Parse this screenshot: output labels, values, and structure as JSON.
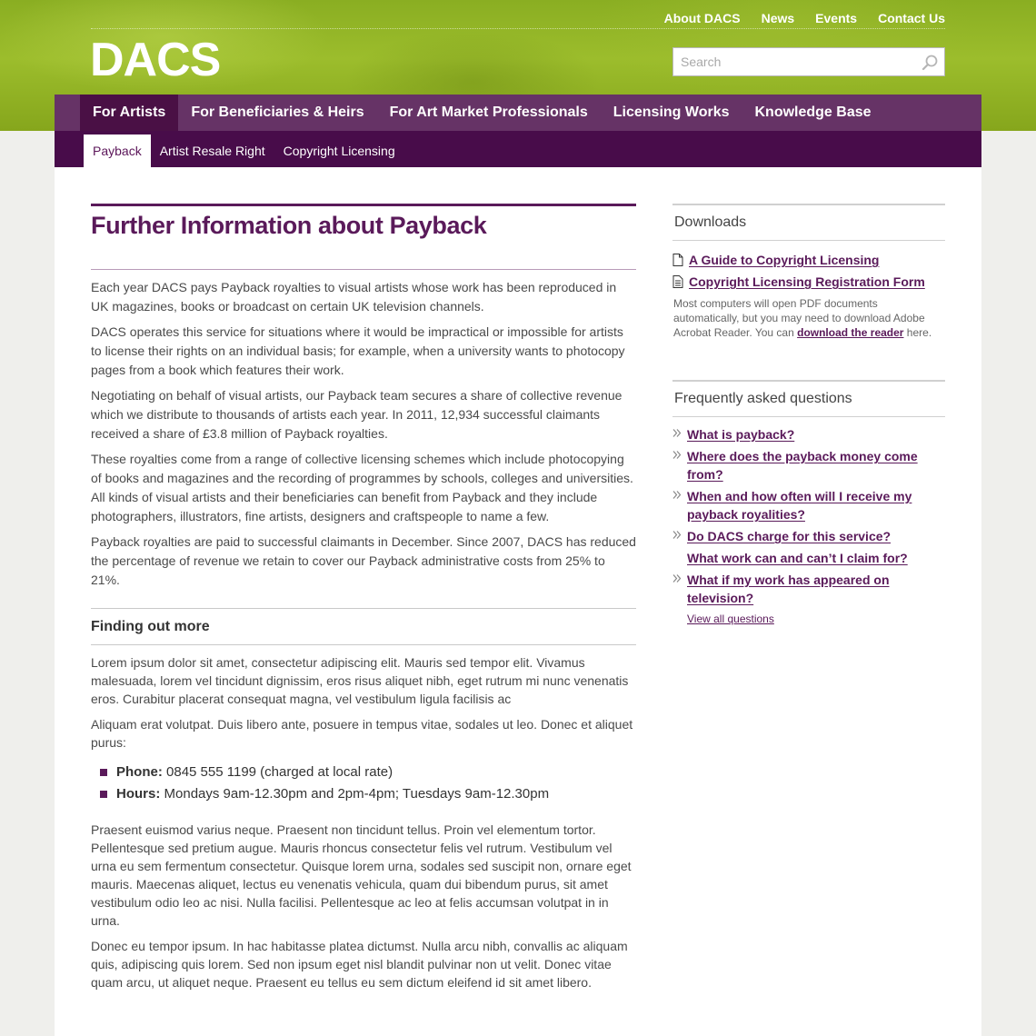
{
  "site": {
    "logo": "DACS",
    "top_links": [
      "About DACS",
      "News",
      "Events",
      "Contact Us"
    ],
    "search_placeholder": "Search"
  },
  "main_nav": [
    {
      "label": "For Artists",
      "active": true
    },
    {
      "label": "For Beneficiaries & Heirs",
      "active": false
    },
    {
      "label": "For Art Market Professionals",
      "active": false
    },
    {
      "label": "Licensing Works",
      "active": false
    },
    {
      "label": "Knowledge Base",
      "active": false
    }
  ],
  "sub_nav": [
    {
      "label": "Payback",
      "active": true
    },
    {
      "label": "Artist Resale Right",
      "active": false
    },
    {
      "label": "Copyright Licensing",
      "active": false
    }
  ],
  "main": {
    "title": "Further Information about Payback",
    "paragraphs": [
      "Each year DACS pays Payback royalties to visual artists whose work has been reproduced in UK magazines, books or broadcast on certain UK television channels.",
      "DACS operates this service for situations where it would be impractical or impossible for artists to license their rights on an individual basis; for example, when a university wants to photocopy pages from a book which features their work.",
      "Negotiating on behalf of visual artists, our Payback team secures a share of collective revenue which we distribute to thousands of artists each year. In 2011, 12,934 successful claimants received a share of £3.8 million of Payback royalties.",
      "These royalties come from a range of collective licensing schemes which include photocopying of books and magazines and the recording of programmes by schools, colleges and universities. All kinds of visual artists and their beneficiaries can benefit from Payback and they include photographers, illustrators, fine artists, designers and craftspeople to name a few.",
      "Payback royalties are paid to successful claimants in December. Since 2007, DACS has reduced the percentage of revenue we retain to cover our Payback administrative costs from 25% to 21%."
    ],
    "section_heading": "Finding out more",
    "section_paragraphs": [
      "Lorem ipsum dolor sit amet, consectetur adipiscing elit. Mauris sed tempor elit. Vivamus malesuada, lorem vel tincidunt dignissim, eros risus aliquet nibh, eget rutrum mi nunc venenatis eros. Curabitur placerat consequat magna, vel vestibulum ligula facilisis ac",
      "Aliquam erat volutpat. Duis libero ante, posuere in tempus vitae, sodales ut leo. Donec et aliquet purus:"
    ],
    "contact": [
      {
        "label": "Phone:",
        "value": "0845 555 1199  (charged at local rate)"
      },
      {
        "label": "Hours:",
        "value": "Mondays 9am-12.30pm and 2pm-4pm; Tuesdays 9am-12.30pm"
      }
    ],
    "closing_paragraphs": [
      "Praesent euismod varius neque. Praesent non tincidunt tellus. Proin vel elementum tortor. Pellentesque sed pretium augue. Mauris rhoncus consectetur felis vel rutrum. Vestibulum vel urna eu sem fermentum consectetur. Quisque lorem urna, sodales sed suscipit non, ornare eget mauris. Maecenas aliquet, lectus eu venenatis vehicula, quam dui bibendum purus, sit amet vestibulum odio leo ac nisi. Nulla facilisi. Pellentesque ac leo at felis accumsan volutpat in in urna.",
      "Donec eu tempor ipsum. In hac habitasse platea dictumst. Nulla arcu nibh, convallis ac aliquam quis, adipiscing quis lorem. Sed non ipsum eget nisl blandit pulvinar non ut velit. Donec vitae quam arcu, ut aliquet neque. Praesent eu tellus eu sem dictum eleifend id sit amet libero."
    ]
  },
  "downloads": {
    "heading": "Downloads",
    "items": [
      "A Guide to Copyright Licensing",
      "Copyright Licensing Registration Form"
    ],
    "note_before": "Most computers will open PDF documents automatically, but you may need to download Adobe Acrobat Reader. You can ",
    "note_link": "download the reader",
    "note_after": " here."
  },
  "faq": {
    "heading": "Frequently asked questions",
    "items": [
      {
        "text": "What is payback?",
        "icon": true
      },
      {
        "text": "Where does the payback money come from?",
        "icon": true
      },
      {
        "text": "When and how often will I receive my payback royalities?",
        "icon": true
      },
      {
        "text": "Do DACS charge for this service?",
        "icon": true
      },
      {
        "text": "What work can and can’t I claim for?",
        "icon": false
      },
      {
        "text": "What if my work has appeared on television?",
        "icon": true
      }
    ],
    "view_all": "View all questions"
  },
  "colors": {
    "brand_purple": "#5a1a5a",
    "nav_purple": "#663366",
    "subnav_purple": "#480c4a",
    "header_green": "#9cbd2c"
  }
}
